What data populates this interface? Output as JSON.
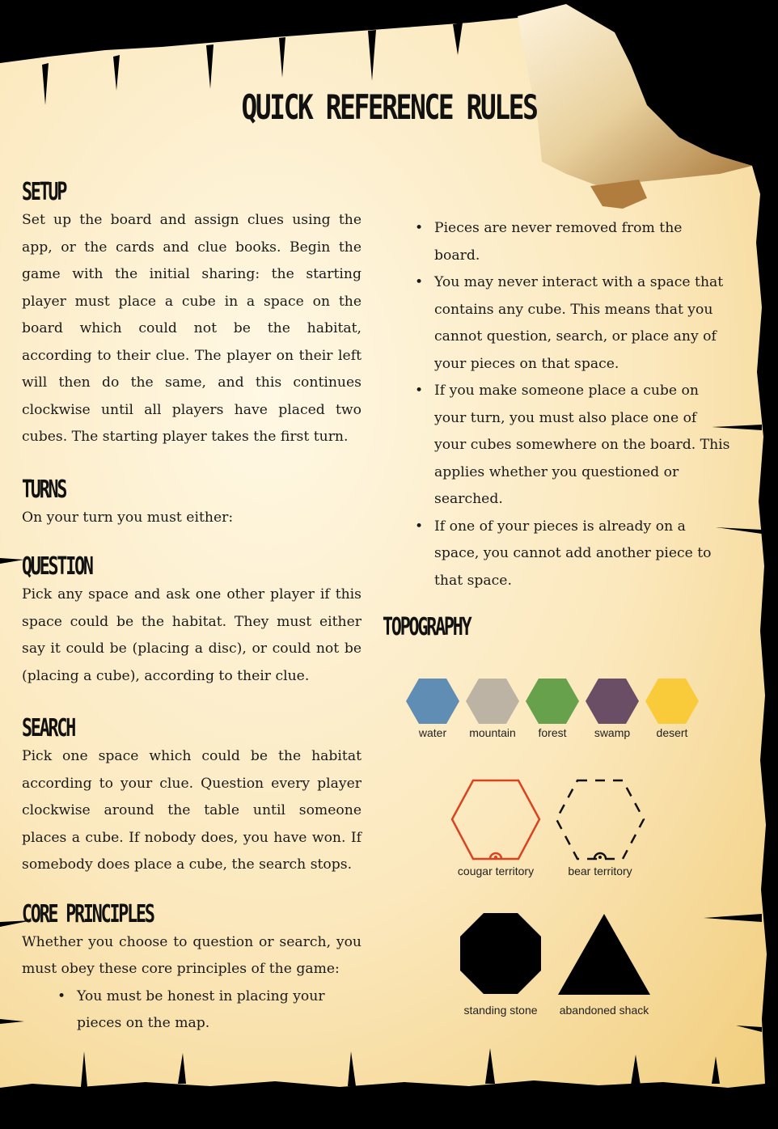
{
  "title": "QUICK REFERENCE RULES",
  "sections": {
    "setup": {
      "heading": "SETUP",
      "text": "Set up the board and assign clues using the app, or the cards and clue books. Begin the game with the initial sharing: the starting player must place a cube in a space on the board which could not be the habitat, according to their clue. The player on their left will then do the same, and this continues clockwise until all players have placed two cubes. The starting player takes the first turn."
    },
    "turns": {
      "heading": "TURNS",
      "text": "On your turn you must either:"
    },
    "question": {
      "heading": "QUESTION",
      "text": "Pick any space and ask one other player if this space could be the habitat. They must either say it could be (placing a disc), or could not be (placing a cube), according to their clue."
    },
    "search": {
      "heading": "SEARCH",
      "text": "Pick one space which could be the habitat according to your clue. Question every player clockwise around the table until someone places a cube. If nobody does, you have won. If somebody does place a cube, the search stops."
    },
    "core": {
      "heading": "CORE PRINCIPLES",
      "text": "Whether you choose to question or search, you must obey these core principles of the game:",
      "bullets": [
        "You must be honest in placing your pieces on the map.",
        "Pieces are never removed from the board.",
        "You may never interact with a space that contains any cube. This means that you cannot question, search, or place any of your pieces on that space.",
        "If you make someone place a cube on your turn, you must also place one of your cubes somewhere on the board. This applies whether you questioned or searched.",
        "If one of your pieces is already on a space, you cannot add another piece to that space."
      ]
    },
    "topography": {
      "heading": "TOPOGRAPHY",
      "terrains": [
        {
          "label": "water",
          "color": "#5f8db3"
        },
        {
          "label": "mountain",
          "color": "#bdb3a5"
        },
        {
          "label": "forest",
          "color": "#67a14b"
        },
        {
          "label": "swamp",
          "color": "#6a4e66"
        },
        {
          "label": "desert",
          "color": "#f9cb3a"
        }
      ],
      "territories": [
        {
          "label": "cougar territory",
          "color": "#d9431f"
        },
        {
          "label": "bear territory",
          "color": "#111111"
        }
      ],
      "structures": [
        {
          "label": "standing stone"
        },
        {
          "label": "abandoned shack"
        }
      ]
    }
  }
}
